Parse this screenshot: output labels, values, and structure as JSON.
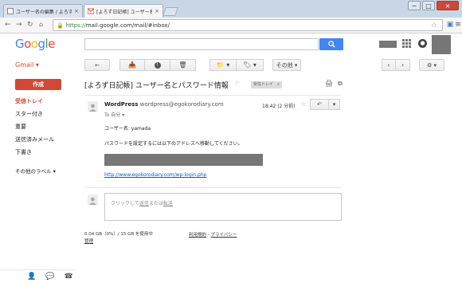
{
  "browser": {
    "tabs": [
      {
        "title": "ユーザー名の編集 / よろず日記",
        "close": "×"
      },
      {
        "title": "[よろず日記帳] ユーザー名と",
        "close": "×"
      }
    ],
    "url_scheme": "https://",
    "url_rest": "mail.google.com/mail/#inbox/",
    "window_controls": [
      "−",
      "□",
      "×"
    ]
  },
  "header": {
    "logo_letters": [
      "G",
      "o",
      "o",
      "g",
      "l",
      "e"
    ],
    "logo_colors": [
      "#4285f4",
      "#ea4335",
      "#fbbc05",
      "#4285f4",
      "#34a853",
      "#ea4335"
    ],
    "search_placeholder": ""
  },
  "gmail_label": "Gmail ▾",
  "actions": {
    "more_label": "その他 ▾",
    "settings_label": "⚙ ▾"
  },
  "sidebar": {
    "compose_label": "作成",
    "items": [
      {
        "label": "受信トレイ",
        "active": true
      },
      {
        "label": "スター付き",
        "active": false
      },
      {
        "label": "重要",
        "active": false
      },
      {
        "label": "送信済みメール",
        "active": false
      },
      {
        "label": "下書き",
        "active": false
      },
      {
        "label": "その他のラベル ▾",
        "active": false
      }
    ]
  },
  "thread": {
    "subject": "[よろず日記帳] ユーザー名とパスワード情報",
    "label_chip": "受信トレイ",
    "label_chip_close": "x"
  },
  "message": {
    "sender_name": "WordPress",
    "sender_email": "wordpress@egokorodiary.com",
    "to": "To 自分 ▾",
    "date": "18:42 (2 分前)",
    "body_username": "ユーザー名: yamada",
    "body_instruction": "パスワードを設定するには以下のアドレスへ移動してください。",
    "link": "http://www.egokorodiary.com/wp-login.php"
  },
  "reply_box": {
    "prefix": "クリックして",
    "reply": "返信",
    "middle": "または",
    "forward": "転送"
  },
  "footer": {
    "storage": "0.04 GB（0%）/ 15 GB を使用中",
    "manage": "管理",
    "terms": "利用規約",
    "separator": " - ",
    "privacy": "プライバシー"
  }
}
